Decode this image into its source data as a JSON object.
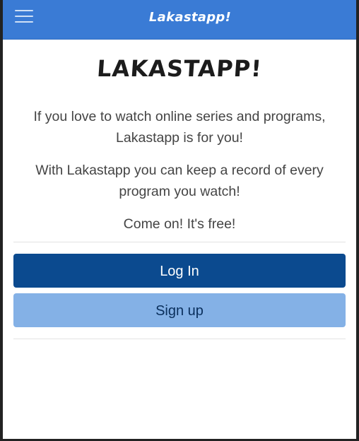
{
  "navbar": {
    "brand": "Lakastapp!",
    "menu_icon": "hamburger-menu-icon",
    "background": "#3a7bd5"
  },
  "main": {
    "title": "LAKASTAPP!",
    "paragraph1": "If you love to watch online series and programs, Lakastapp is for you!",
    "paragraph2": "With Lakastapp you can keep a record of every program you watch!",
    "paragraph3": "Come on! It's free!"
  },
  "actions": {
    "login_label": "Log In",
    "signup_label": "Sign up",
    "login_color": "#0b4a8f",
    "signup_color": "#84b1e6"
  }
}
